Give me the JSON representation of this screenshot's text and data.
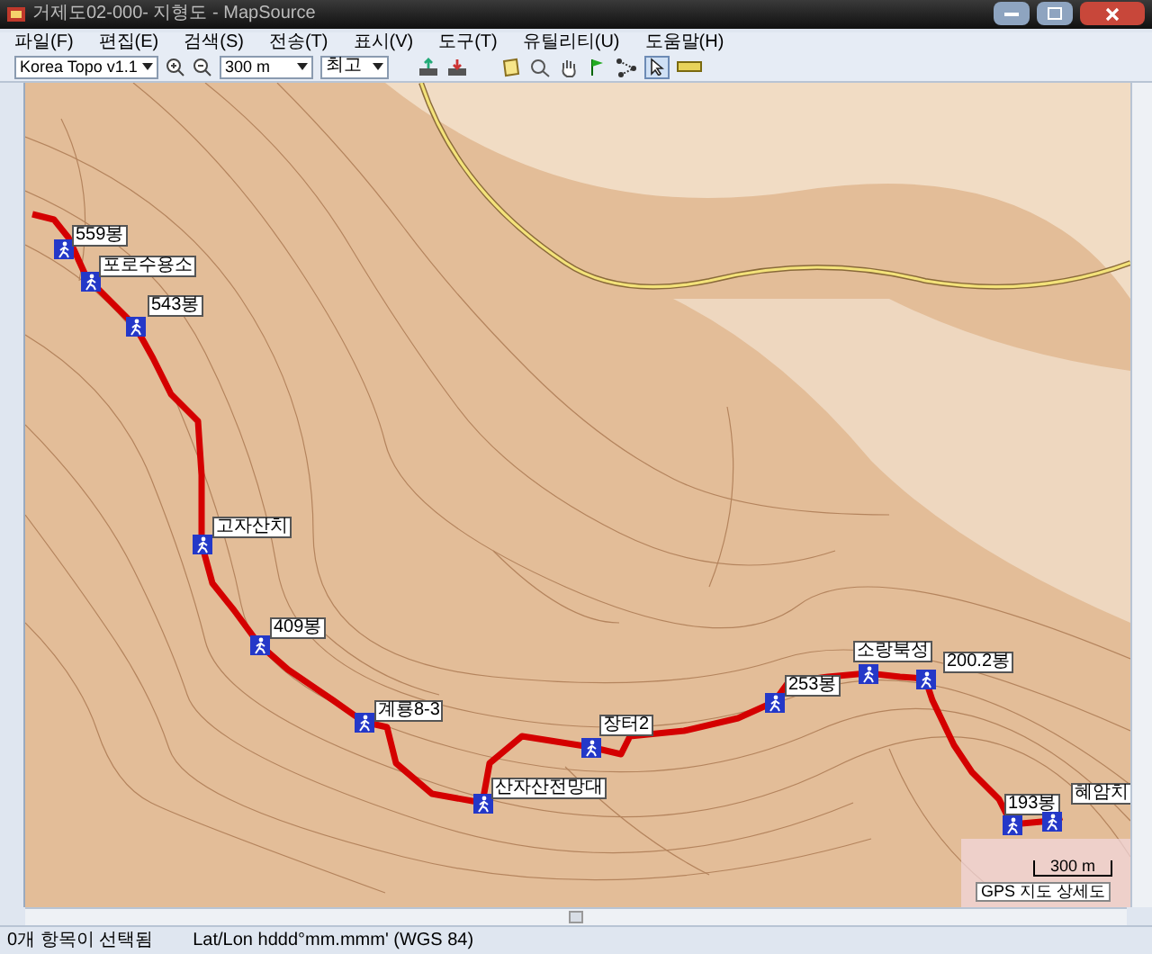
{
  "window": {
    "title": "거제도02-000- 지형도 - MapSource"
  },
  "menu": [
    "파일(F)",
    "편집(E)",
    "검색(S)",
    "전송(T)",
    "표시(V)",
    "도구(T)",
    "유틸리티(U)",
    "도움말(H)"
  ],
  "toolbar": {
    "map_product": "Korea Topo v1.1",
    "zoom_scale": "300 m",
    "detail": "최고"
  },
  "waypoints": [
    {
      "label": "559봉"
    },
    {
      "label": "포로수용소"
    },
    {
      "label": "543봉"
    },
    {
      "label": "고자산치"
    },
    {
      "label": "409봉"
    },
    {
      "label": "계룡8-3"
    },
    {
      "label": "산자산전망대"
    },
    {
      "label": "장터2"
    },
    {
      "label": "253봉"
    },
    {
      "label": "소랑북성"
    },
    {
      "label": "200.2봉"
    },
    {
      "label": "193봉"
    },
    {
      "label": "혜암치"
    }
  ],
  "map": {
    "scale": "300 m",
    "detail_label": "GPS 지도 상세도"
  },
  "status_bar": {
    "selection": "0개 항목이 선택됨",
    "position_format": "Lat/Lon hddd°mm.mmm' (WGS 84)"
  }
}
